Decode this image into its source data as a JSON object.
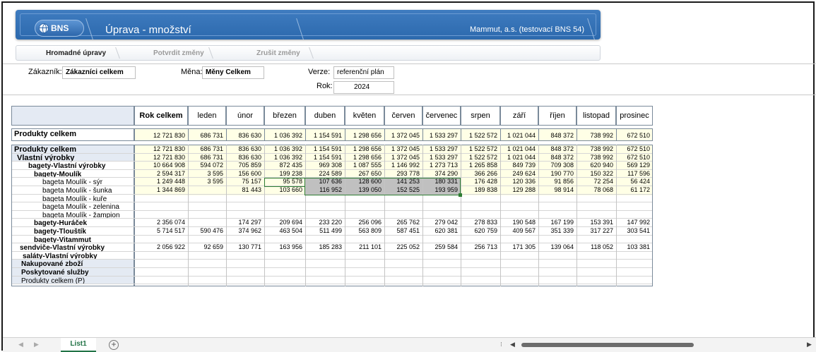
{
  "header": {
    "logo": "BNS",
    "title": "Úprava - množství",
    "company": "Mammut, a.s. (testovací BNS 54)"
  },
  "actions": {
    "bulk_edit": "Hromadné úpravy",
    "confirm": "Potvrdit změny",
    "cancel": "Zrušit změny"
  },
  "filters": {
    "customer_label": "Zákazník:",
    "customer_value": "Zákazníci celkem",
    "currency_label": "Měna:",
    "currency_value": "Měny Celkem",
    "version_label": "Verze:",
    "version_value": "referenční plán",
    "year_label": "Rok:",
    "year_value": "2024"
  },
  "grid": {
    "total_header": "Rok celkem",
    "months": [
      "leden",
      "únor",
      "březen",
      "duben",
      "květen",
      "červen",
      "červenec",
      "srpen",
      "září",
      "říjen",
      "listopad",
      "prosinec"
    ],
    "summary": {
      "label": "Produkty celkem",
      "values": [
        "12 721 830",
        "686 731",
        "836 630",
        "1 036 392",
        "1 154 591",
        "1 298 656",
        "1 372 045",
        "1 533 297",
        "1 522 572",
        "1 021 044",
        "848 372",
        "738 992",
        "672 510"
      ]
    },
    "rows": [
      {
        "label": "Produkty celkem",
        "values": [
          "12 721 830",
          "686 731",
          "836 630",
          "1 036 392",
          "1 154 591",
          "1 298 656",
          "1 372 045",
          "1 533 297",
          "1 522 572",
          "1 021 044",
          "848 372",
          "738 992",
          "672 510"
        ]
      },
      {
        "label": "Vlastní výrobky",
        "values": [
          "12 721 830",
          "686 731",
          "836 630",
          "1 036 392",
          "1 154 591",
          "1 298 656",
          "1 372 045",
          "1 533 297",
          "1 522 572",
          "1 021 044",
          "848 372",
          "738 992",
          "672 510"
        ]
      },
      {
        "label": "bagety-Vlastní výrobky",
        "values": [
          "10 664 908",
          "594 072",
          "705 859",
          "872 435",
          "969 308",
          "1 087 555",
          "1 146 992",
          "1 273 713",
          "1 265 858",
          "849 739",
          "709 308",
          "620 940",
          "569 129"
        ]
      },
      {
        "label": "bagety-Moulík",
        "values": [
          "2 594 317",
          "3 595",
          "156 600",
          "199 238",
          "224 589",
          "267 650",
          "293 778",
          "374 290",
          "366 266",
          "249 624",
          "190 770",
          "150 322",
          "117 596"
        ]
      },
      {
        "label": "bageta Moulík - sýr",
        "values": [
          "1 249 448",
          "3 595",
          "75 157",
          "95 578",
          "107 636",
          "128 600",
          "141 253",
          "180 331",
          "176 428",
          "120 336",
          "91 856",
          "72 254",
          "56 424"
        ]
      },
      {
        "label": "bageta Moulík - šunka",
        "values": [
          "1 344 869",
          "",
          "81 443",
          "103 660",
          "116 952",
          "139 050",
          "152 525",
          "193 959",
          "189 838",
          "129 288",
          "98 914",
          "78 068",
          "61 172"
        ]
      },
      {
        "label": "bageta Moulík - kuře",
        "values": [
          "",
          "",
          "",
          "",
          "",
          "",
          "",
          "",
          "",
          "",
          "",
          "",
          ""
        ]
      },
      {
        "label": "bageta Moulík - zelenina",
        "values": [
          "",
          "",
          "",
          "",
          "",
          "",
          "",
          "",
          "",
          "",
          "",
          "",
          ""
        ]
      },
      {
        "label": "bageta Moulík - žampion",
        "values": [
          "",
          "",
          "",
          "",
          "",
          "",
          "",
          "",
          "",
          "",
          "",
          "",
          ""
        ]
      },
      {
        "label": "bagety-Huráček",
        "values": [
          "2 356 074",
          "",
          "174 297",
          "209 694",
          "233 220",
          "256 096",
          "265 762",
          "279 042",
          "278 833",
          "190 548",
          "167 199",
          "153 391",
          "147 992"
        ]
      },
      {
        "label": "bagety-Tlouštík",
        "values": [
          "5 714 517",
          "590 476",
          "374 962",
          "463 504",
          "511 499",
          "563 809",
          "587 451",
          "620 381",
          "620 759",
          "409 567",
          "351 339",
          "317 227",
          "303 541"
        ]
      },
      {
        "label": "bagety-Vitammut",
        "values": [
          "",
          "",
          "",
          "",
          "",
          "",
          "",
          "",
          "",
          "",
          "",
          "",
          ""
        ]
      },
      {
        "label": "sendviče-Vlastní výrobky",
        "values": [
          "2 056 922",
          "92 659",
          "130 771",
          "163 956",
          "185 283",
          "211 101",
          "225 052",
          "259 584",
          "256 713",
          "171 305",
          "139 064",
          "118 052",
          "103 381"
        ]
      },
      {
        "label": "saláty-Vlastní výrobky",
        "values": [
          "",
          "",
          "",
          "",
          "",
          "",
          "",
          "",
          "",
          "",
          "",
          "",
          ""
        ]
      },
      {
        "label": "Nakupované zboží",
        "values": [
          "",
          "",
          "",
          "",
          "",
          "",
          "",
          "",
          "",
          "",
          "",
          "",
          ""
        ]
      },
      {
        "label": "Poskytované služby",
        "values": [
          "",
          "",
          "",
          "",
          "",
          "",
          "",
          "",
          "",
          "",
          "",
          "",
          ""
        ]
      },
      {
        "label": "Produkty celkem (P)",
        "values": [
          "",
          "",
          "",
          "",
          "",
          "",
          "",
          "",
          "",
          "",
          "",
          "",
          ""
        ]
      }
    ]
  },
  "sheets": {
    "active": "List1",
    "add_icon": "+"
  },
  "colors": {
    "banner": "#2f6cb0",
    "data_fill": "#ffffe6",
    "selection": "#c0c0c0",
    "sheet_tab": "#217346"
  }
}
